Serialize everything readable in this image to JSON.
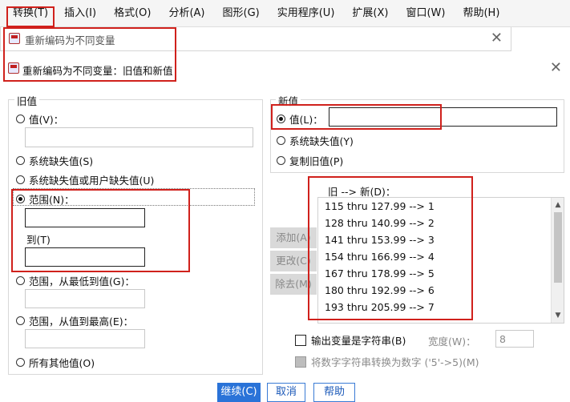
{
  "menubar": {
    "items": [
      "转换(T)",
      "插入(I)",
      "格式(O)",
      "分析(A)",
      "图形(G)",
      "实用程序(U)",
      "扩展(X)",
      "窗口(W)",
      "帮助(H)"
    ]
  },
  "background_window": {
    "title": "重新编码为不同变量"
  },
  "dialog": {
    "title": "重新编码为不同变量：旧值和新值"
  },
  "old_value": {
    "group_label": "旧值",
    "value_label": "值(V)：",
    "system_missing_label": "系统缺失值(S)",
    "system_or_user_missing_label": "系统缺失值或用户缺失值(U)",
    "range_label": "范围(N)：",
    "range_from": "",
    "range_to_label": "到(T)",
    "range_to": "",
    "range_lowest_label": "范围，从最低到值(G)：",
    "range_highest_label": "范围，从值到最高(E)：",
    "all_other_label": "所有其他值(O)"
  },
  "new_value": {
    "group_label": "新值",
    "value_label": "值(L)：",
    "value": "",
    "system_missing_label": "系统缺失值(Y)",
    "copy_old_label": "复制旧值(P)"
  },
  "side_buttons": {
    "add": "添加(A)",
    "change": "更改(C)",
    "remove": "除去(M)"
  },
  "mapping": {
    "header": "旧 --> 新(D)：",
    "rows": [
      "115 thru 127.99 --> 1",
      "128 thru 140.99 --> 2",
      "141 thru 153.99 --> 3",
      "154 thru 166.99 --> 4",
      "167 thru 178.99 --> 5",
      "180 thru 192.99 --> 6",
      "193 thru 205.99 --> 7"
    ]
  },
  "options": {
    "output_string_label": "输出变量是字符串(B)",
    "width_label": "宽度(W)：",
    "width_value": "8",
    "convert_numeric_label": "将数字字符串转换为数字 ('5'->5)(M)"
  },
  "footer_buttons": {
    "continue": "继续(C)",
    "cancel": "取消",
    "help": "帮助"
  },
  "colors": {
    "highlight": "#d0211c",
    "primary_button": "#2a73d8"
  }
}
